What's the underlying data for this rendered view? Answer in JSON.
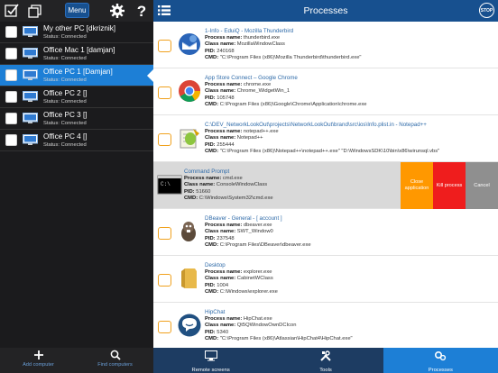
{
  "left": {
    "toolbar": {
      "menu_label": "Menu"
    },
    "computers": [
      {
        "name": "My other PC [dkriznik]",
        "status_label": "Status:",
        "status": "Connected",
        "selected": false
      },
      {
        "name": "Office Mac 1 [damjan]",
        "status_label": "Status:",
        "status": "Connected",
        "selected": false
      },
      {
        "name": "Office PC 1 [Damjan]",
        "status_label": "Status:",
        "status": "Connected",
        "selected": true
      },
      {
        "name": "Office PC 2 []",
        "status_label": "Status:",
        "status": "Connected",
        "selected": false
      },
      {
        "name": "Office PC 3 []",
        "status_label": "Status:",
        "status": "Connected",
        "selected": false
      },
      {
        "name": "Office PC 4 []",
        "status_label": "Status:",
        "status": "Connected",
        "selected": false
      }
    ],
    "bottom": {
      "add_label": "Add computer",
      "find_label": "Find computers"
    }
  },
  "right": {
    "title": "Processes",
    "stop_label": "STOP",
    "field_labels": {
      "process": "Process name:",
      "class": "Class name:",
      "pid": "PID:",
      "cmd": "CMD:"
    },
    "processes": [
      {
        "title": "1-Info - EduiQ - Mozilla Thunderbird",
        "process": "thunderbird.exe",
        "class": "MozillaWindowClass",
        "pid": "240168",
        "cmd": "\"C:\\Program Files (x86)\\Mozilla Thunderbird\\thunderbird.exe\"",
        "icon": "thunderbird-icon"
      },
      {
        "title": "App Store Connect – Google Chrome",
        "process": "chrome.exe",
        "class": "Chrome_WidgetWin_1",
        "pid": "105748",
        "cmd": "C:\\Program Files (x86)\\Google\\Chrome\\Application\\chrome.exe",
        "icon": "chrome-icon"
      },
      {
        "title": "C:\\DEV_NetworkLookOut\\projects\\NetworkLookOut\\brand\\src\\ios\\Info.plist.in - Notepad++",
        "process": "notepad++.exe",
        "class": "Notepad++",
        "pid": "255444",
        "cmd": "\"C:\\Program Files (x86)\\Notepad++\\notepad++.exe\" \"D:\\WindowsSDK\\10\\bin\\x86\\wirunsql.vbs\"",
        "icon": "notepadpp-icon"
      },
      {
        "title": "Command Prompt",
        "process": "cmd.exe",
        "class": "ConsoleWindowClass",
        "pid": "51660",
        "cmd": "C:\\Windows\\System32\\cmd.exe",
        "icon": "cmd-icon",
        "active": true
      },
      {
        "title": "DBeaver - General - [ account ]",
        "process": "dbeaver.exe",
        "class": "SWT_Window0",
        "pid": "237548",
        "cmd": "C:\\Program Files\\DBeaver\\dbeaver.exe",
        "icon": "dbeaver-icon"
      },
      {
        "title": "Desktop",
        "process": "explorer.exe",
        "class": "CabinetWClass",
        "pid": "1004",
        "cmd": "C:\\Windows\\explorer.exe",
        "icon": "folder-icon"
      },
      {
        "title": "HipChat",
        "process": "HipChat.exe",
        "class": "Qt5QWindowOwnDCIcon",
        "pid": "5340",
        "cmd": "\"C:\\Program Files (x86)\\Atlassian\\HipChat4\\HipChat.exe\"",
        "icon": "hipchat-icon"
      }
    ],
    "actions": {
      "close_app": "Close application",
      "kill_process": "Kill process",
      "cancel": "Cancel"
    },
    "tabs": [
      {
        "label": "Remote screens",
        "icon": "monitor-icon",
        "active": false
      },
      {
        "label": "Tools",
        "icon": "tools-icon",
        "active": false
      },
      {
        "label": "Processes",
        "icon": "processes-icon",
        "active": true
      }
    ]
  },
  "colors": {
    "accent_blue": "#17508f",
    "selected_blue": "#1d7fd6",
    "checkbox_orange": "#f0a11d",
    "close_orange": "#ff9800",
    "kill_red": "#ef1d1d",
    "cancel_gray": "#8f8f8f"
  }
}
